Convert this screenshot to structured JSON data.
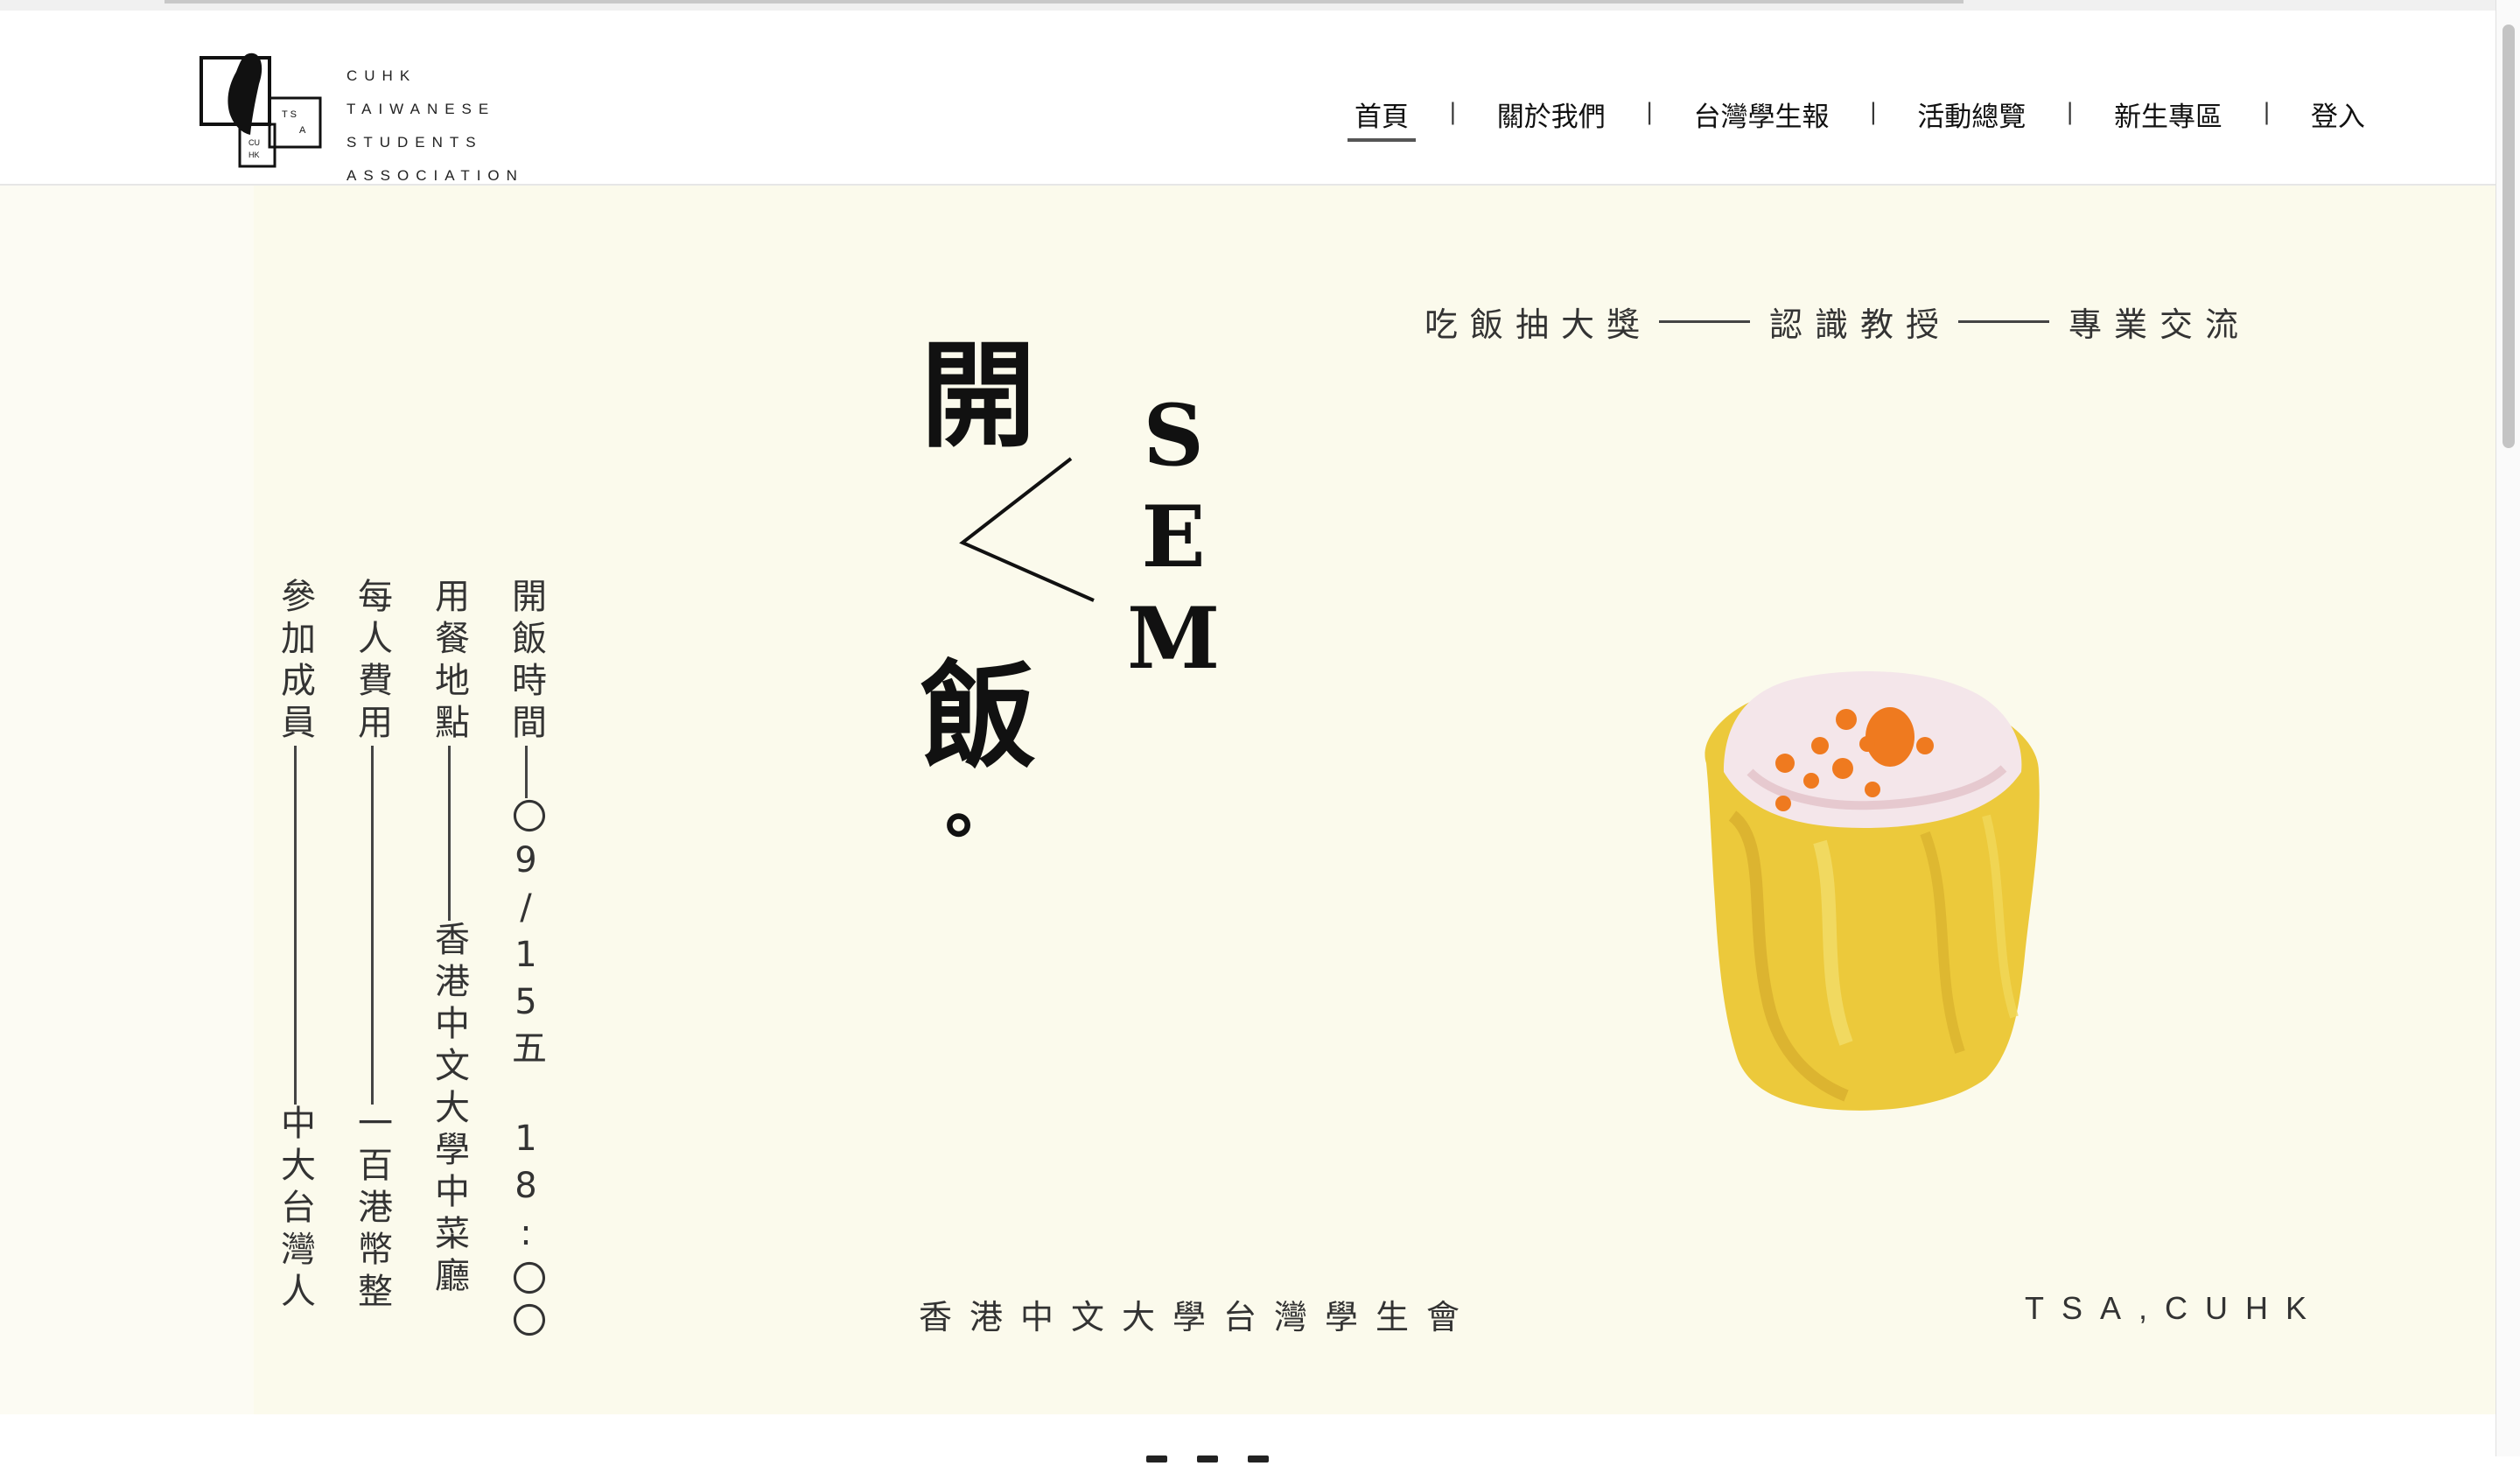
{
  "logo": {
    "lines": [
      "CUHK",
      "TAIWANESE",
      "STUDENTS",
      "ASSOCIATION"
    ],
    "badge_top": "T S",
    "badge_mid": "A",
    "badge_low": "CU",
    "badge_low2": "HK"
  },
  "nav": {
    "items": [
      {
        "label": "首頁",
        "active": true
      },
      {
        "label": "關於我們"
      },
      {
        "label": "台灣學生報"
      },
      {
        "label": "活動總覽"
      },
      {
        "label": "新生專區"
      },
      {
        "label": "登入"
      }
    ],
    "separator": "|"
  },
  "hero": {
    "title_top": "開",
    "title_bottom": "飯",
    "title_dot": "。",
    "sem_letters": [
      "S",
      "E",
      "M"
    ],
    "tagline": [
      "吃飯抽大獎",
      "認識教授",
      "專業交流"
    ],
    "info": [
      {
        "label": "開飯時間",
        "value": "〇9/15五 18:〇〇"
      },
      {
        "label": "用餐地點",
        "value": "香港中文大學中菜廳"
      },
      {
        "label": "每人費用",
        "value": "一百港幣整"
      },
      {
        "label": "參加成員",
        "value": "中大台灣人"
      }
    ],
    "footer_left": "香港中文大學台灣學生會",
    "footer_right": "TSA,CUHK"
  },
  "colors": {
    "hero_bg": "#fbfaec",
    "shumai_wrapper": "#eccc3c",
    "shumai_filling": "#f6e9ec",
    "roe": "#ef7a1f"
  }
}
